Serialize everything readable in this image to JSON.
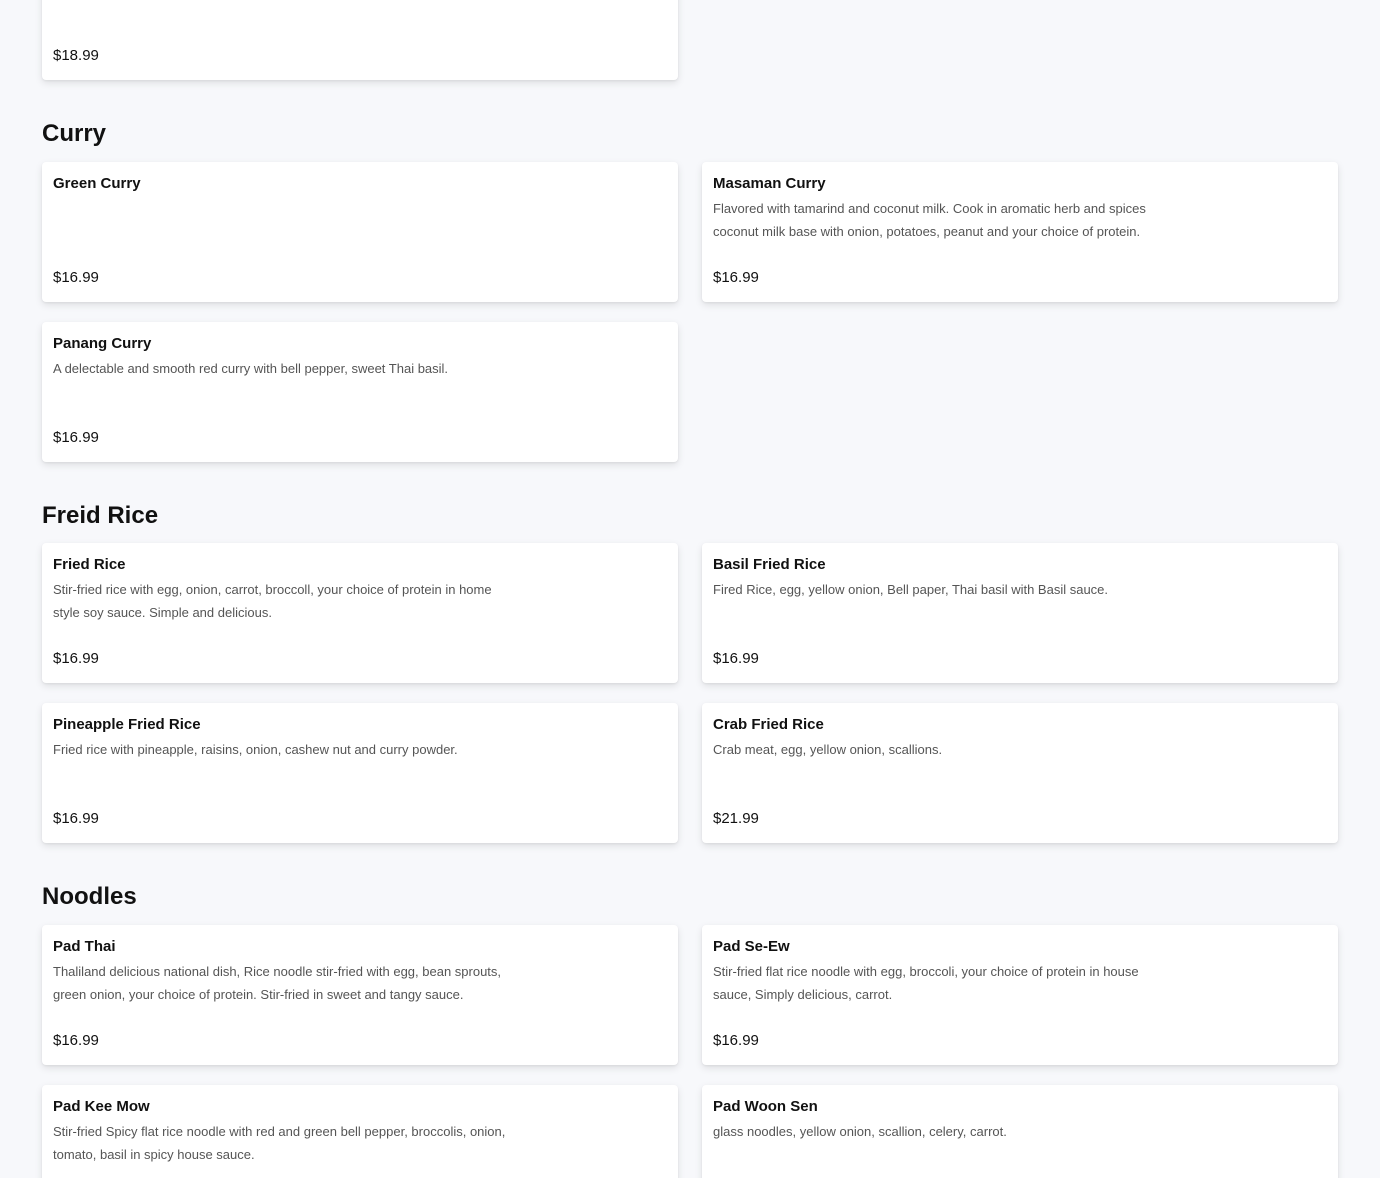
{
  "top_item": {
    "price": "$18.99"
  },
  "sections": {
    "curry": {
      "title": "Curry",
      "items": [
        {
          "name": "Green Curry",
          "description": "",
          "price": "$16.99"
        },
        {
          "name": "Masaman Curry",
          "description": "Flavored with tamarind and coconut milk. Cook in aromatic herb and spices coconut milk base with onion, potatoes, peanut and your choice of protein.",
          "price": "$16.99"
        },
        {
          "name": "Panang Curry",
          "description": "A delectable and smooth red curry with bell pepper, sweet Thai basil.",
          "price": "$16.99"
        }
      ]
    },
    "fried_rice": {
      "title": "Freid Rice",
      "items": [
        {
          "name": "Fried Rice",
          "description": "Stir-fried rice with egg, onion, carrot, broccoll, your choice of protein in home style soy sauce. Simple and delicious.",
          "price": "$16.99"
        },
        {
          "name": "Basil Fried Rice",
          "description": "Fired Rice, egg, yellow onion, Bell paper, Thai basil with Basil sauce.",
          "price": "$16.99"
        },
        {
          "name": "Pineapple Fried Rice",
          "description": "Fried rice with pineapple, raisins, onion, cashew nut and curry powder.",
          "price": "$16.99"
        },
        {
          "name": "Crab Fried Rice",
          "description": "Crab meat, egg, yellow onion, scallions.",
          "price": "$21.99"
        }
      ]
    },
    "noodles": {
      "title": "Noodles",
      "items": [
        {
          "name": "Pad Thai",
          "description": "Thaliland delicious national dish, Rice noodle stir-fried with egg, bean sprouts, green onion, your choice of protein. Stir-fried in sweet and tangy sauce.",
          "price": "$16.99"
        },
        {
          "name": "Pad Se-Ew",
          "description": "Stir-fried flat rice noodle with egg, broccoli, your choice of protein in house sauce, Simply delicious, carrot.",
          "price": "$16.99"
        },
        {
          "name": "Pad Kee Mow",
          "description": "Stir-fried Spicy flat rice noodle with red and green bell pepper, broccolis, onion, tomato, basil in spicy house sauce.",
          "price": ""
        },
        {
          "name": "Pad Woon Sen",
          "description": "glass noodles, yellow onion, scallion, celery, carrot.",
          "price": ""
        }
      ]
    }
  }
}
